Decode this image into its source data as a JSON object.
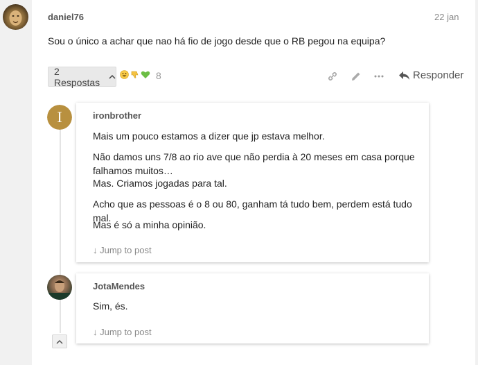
{
  "main_post": {
    "author": "daniel76",
    "date": "22 jan",
    "text": "Sou o único a achar que nao há fio de jogo desde que o RB pegou na equipa?",
    "replies_button": "2 Respostas",
    "reactions": [
      "grinning-face",
      "thumbs-down",
      "green-heart"
    ],
    "reaction_count": "8",
    "reply_label": "Responder"
  },
  "replies": [
    {
      "author": "ironbrother",
      "avatar_letter": "I",
      "avatar_color": "#b8903f",
      "paragraphs": [
        "Mais um pouco estamos a dizer que jp estava melhor.",
        "Não damos uns 7/8 ao rio ave que não perdia à 20 meses em casa porque falhamos muitos…",
        "Mas. Criamos jogadas para tal.",
        "Acho que as pessoas é o 8 ou 80, ganham tá tudo bem, perdem está tudo mal.",
        "Mas é só a minha opinião."
      ],
      "jump_label": "Jump to post"
    },
    {
      "author": "JotaMendes",
      "paragraphs": [
        "Sim, és."
      ],
      "jump_label": "Jump to post"
    }
  ]
}
